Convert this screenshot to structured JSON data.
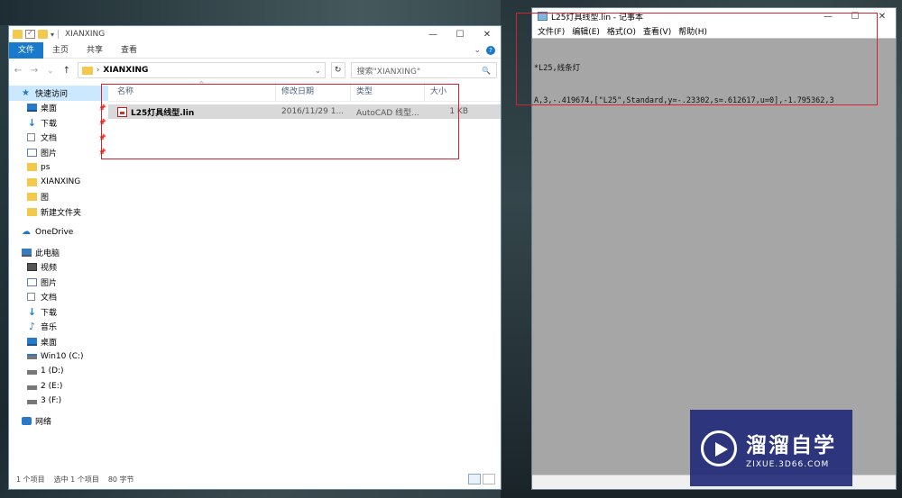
{
  "explorer": {
    "title": "XIANXING",
    "window_controls": {
      "minimize": "—",
      "maximize": "☐",
      "close": "✕"
    },
    "ribbon": {
      "tabs": [
        "文件",
        "主页",
        "共享",
        "查看"
      ],
      "expand_caret": "⌄",
      "help": "?"
    },
    "address": {
      "back": "←",
      "forward": "→",
      "recent": "⌄",
      "up": "↑",
      "separator": "›",
      "path": "XIANXING",
      "dropdown": "⌄",
      "refresh": "↻",
      "search_placeholder": "搜索\"XIANXING\"",
      "search_icon": "🔍"
    },
    "nav": {
      "quick_access": "快速访问",
      "quick_items": [
        "桌面",
        "下载",
        "文档",
        "图片",
        "ps",
        "XIANXING",
        "图",
        "新建文件夹"
      ],
      "onedrive": "OneDrive",
      "this_pc": "此电脑",
      "pc_items": [
        "视频",
        "图片",
        "文档",
        "下载",
        "音乐",
        "桌面",
        "Win10 (C:)",
        "1 (D:)",
        "2 (E:)",
        "3 (F:)"
      ],
      "network": "网络"
    },
    "columns": {
      "name": "名称",
      "date": "修改日期",
      "type": "类型",
      "size": "大小"
    },
    "files": [
      {
        "name": "L25灯具线型.lin",
        "date": "2016/11/29 1...",
        "type": "AutoCAD 线型...",
        "size": "1 KB"
      }
    ],
    "status": {
      "items": "1 个项目",
      "selected": "选中 1 个项目",
      "bytes": "80 字节"
    }
  },
  "notepad": {
    "title": "L25灯具线型.lin - 记事本",
    "window_controls": {
      "minimize": "—",
      "maximize": "☐",
      "close": "✕"
    },
    "menu": [
      "文件(F)",
      "编辑(E)",
      "格式(O)",
      "查看(V)",
      "帮助(H)"
    ],
    "lines": [
      "*L25,线条灯",
      "A,3,-.419674,[\"L25\",Standard,y=-.23302,s=.612617,u=0],-1.795362,3"
    ]
  },
  "watermark": {
    "name": "溜溜自学",
    "url": "ZIXUE.3D66.COM"
  },
  "colors": {
    "accent": "#1979ca",
    "highlight_box": "#d0242f",
    "selection": "#cce8ff",
    "watermark_bg": "#232d78"
  }
}
